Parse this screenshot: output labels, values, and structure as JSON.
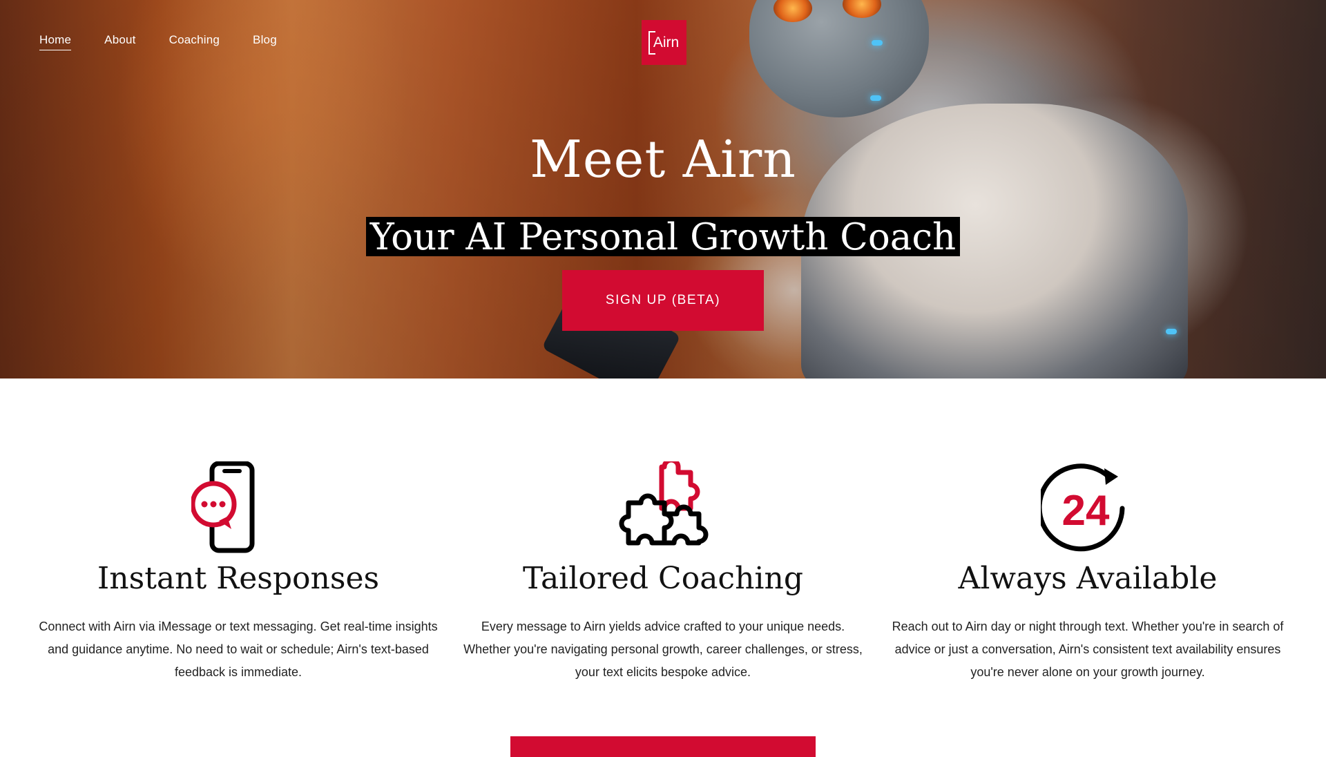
{
  "nav": {
    "items": [
      {
        "label": "Home",
        "active": true
      },
      {
        "label": "About",
        "active": false
      },
      {
        "label": "Coaching",
        "active": false
      },
      {
        "label": "Blog",
        "active": false
      }
    ]
  },
  "logo": {
    "text": "Airn"
  },
  "hero": {
    "title": "Meet Airn",
    "subtitle": "Your AI Personal Growth Coach",
    "cta_label": "SIGN UP (BETA)"
  },
  "features": [
    {
      "icon": "phone-chat-icon",
      "title": "Instant Responses",
      "text": "Connect with Airn via iMessage or text messaging. Get real-time insights and guidance anytime. No need to wait or schedule; Airn's text-based feedback is immediate."
    },
    {
      "icon": "puzzle-icon",
      "title": "Tailored Coaching",
      "text": "Every message to Airn yields advice crafted to your unique needs. Whether you're navigating personal growth, career challenges, or stress, your text elicits bespoke advice."
    },
    {
      "icon": "24-hours-icon",
      "title": "Always Available",
      "text": "Reach out to Airn day or night through text. Whether you're in search of advice or just a conversation, Airn's consistent text availability ensures you're never alone on your growth journey."
    }
  ],
  "colors": {
    "accent": "#d20b31",
    "hero_background": "#a24a1c",
    "text": "#111111"
  }
}
